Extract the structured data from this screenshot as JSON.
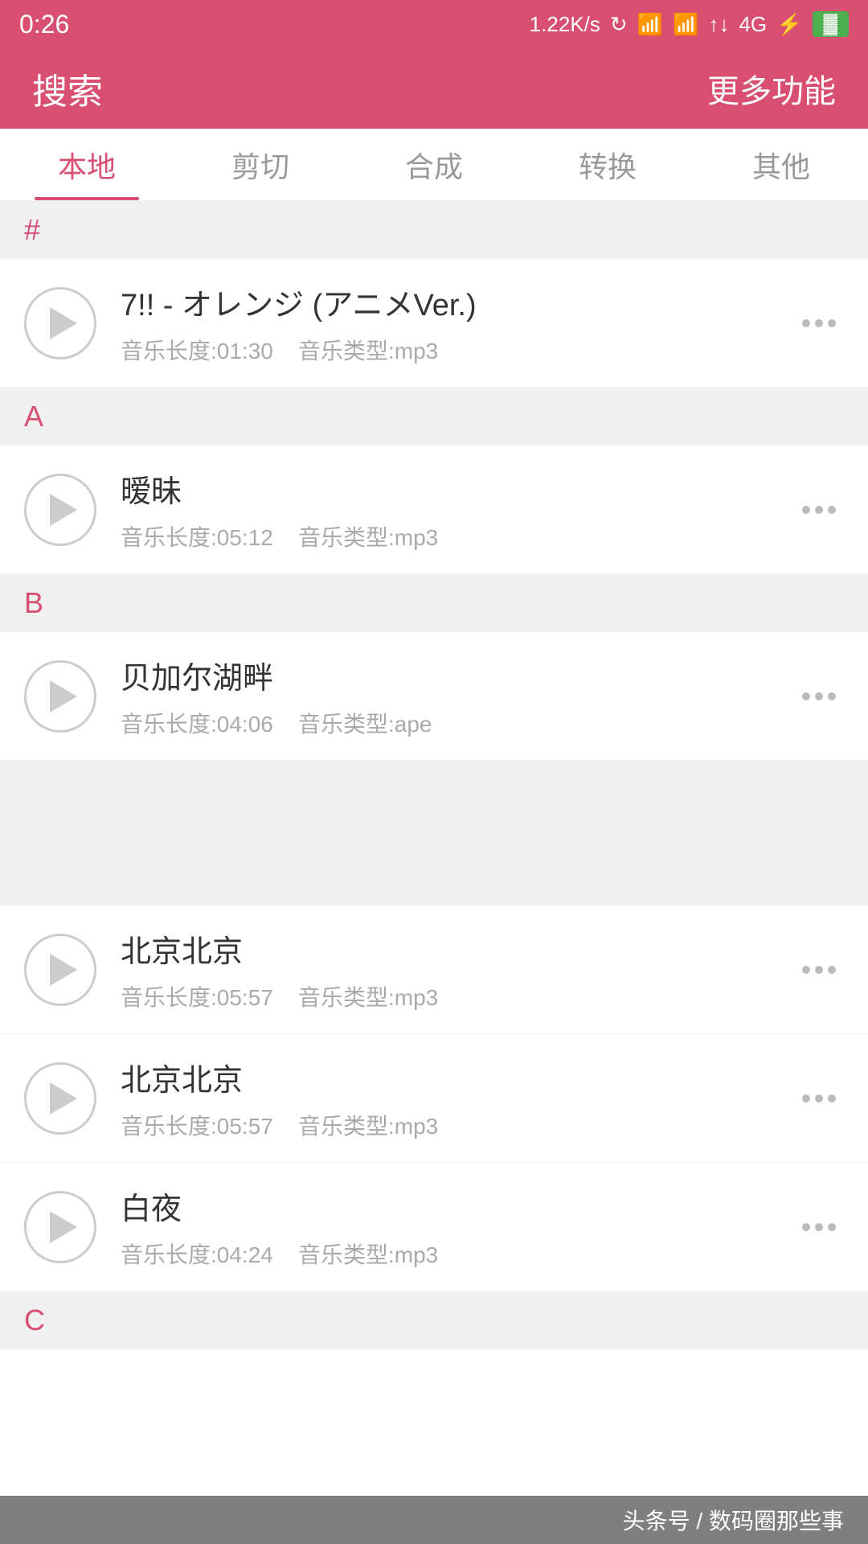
{
  "status": {
    "time": "0:26",
    "network_speed": "1.22K/s",
    "signal": "4G"
  },
  "header": {
    "search_label": "搜索",
    "more_label": "更多功能"
  },
  "tabs": [
    {
      "id": "local",
      "label": "本地",
      "active": true
    },
    {
      "id": "cut",
      "label": "剪切",
      "active": false
    },
    {
      "id": "compose",
      "label": "合成",
      "active": false
    },
    {
      "id": "convert",
      "label": "转换",
      "active": false
    },
    {
      "id": "other",
      "label": "其他",
      "active": false
    }
  ],
  "sections": [
    {
      "letter": "#",
      "items": [
        {
          "title": "7!! - オレンジ (アニメVer.)",
          "duration_label": "音乐长度:01:30",
          "type_label": "音乐类型:mp3"
        }
      ]
    },
    {
      "letter": "A",
      "items": [
        {
          "title": "暧昧",
          "duration_label": "音乐长度:05:12",
          "type_label": "音乐类型:mp3"
        }
      ]
    },
    {
      "letter": "B",
      "items": [
        {
          "title": "贝加尔湖畔",
          "duration_label": "音乐长度:04:06",
          "type_label": "音乐类型:ape"
        }
      ],
      "has_spacer": true
    },
    {
      "letter": "",
      "items": [
        {
          "title": "北京北京",
          "duration_label": "音乐长度:05:57",
          "type_label": "音乐类型:mp3"
        },
        {
          "title": "北京北京",
          "duration_label": "音乐长度:05:57",
          "type_label": "音乐类型:mp3"
        },
        {
          "title": "白夜",
          "duration_label": "音乐长度:04:24",
          "type_label": "音乐类型:mp3"
        }
      ]
    }
  ],
  "bottom_section_letter": "C",
  "watermark": "头条号 / 数码圈那些事"
}
